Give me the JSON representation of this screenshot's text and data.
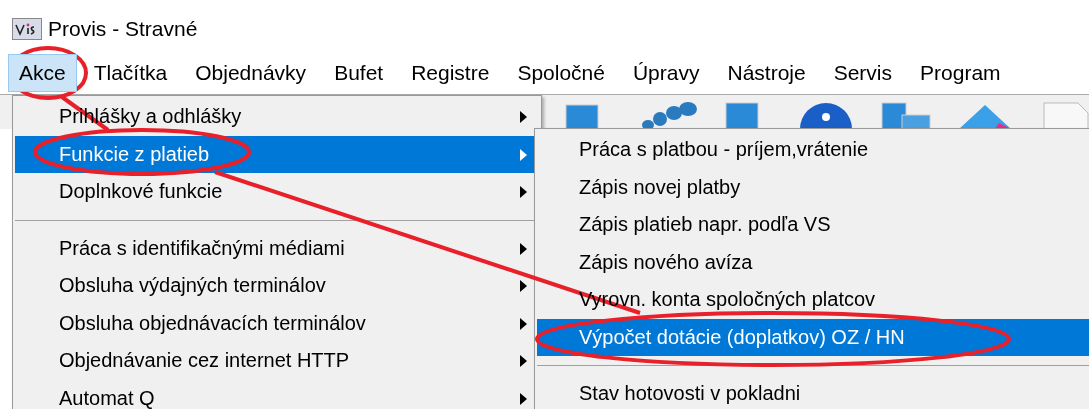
{
  "window": {
    "title": "Provis - Stravné"
  },
  "menu_bar": [
    {
      "label": "Akce",
      "selected": true
    },
    {
      "label": "Tlačítka",
      "selected": false
    },
    {
      "label": "Objednávky",
      "selected": false
    },
    {
      "label": "Bufet",
      "selected": false
    },
    {
      "label": "Registre",
      "selected": false
    },
    {
      "label": "Spoločné",
      "selected": false
    },
    {
      "label": "Úpravy",
      "selected": false
    },
    {
      "label": "Nástroje",
      "selected": false
    },
    {
      "label": "Servis",
      "selected": false
    },
    {
      "label": "Program",
      "selected": false
    }
  ],
  "menu": {
    "items": [
      {
        "kind": "item",
        "label": "Prihlášky a odhlášky",
        "submenu": true,
        "selected": false
      },
      {
        "kind": "item",
        "label": "Funkcie z platieb",
        "submenu": true,
        "selected": true
      },
      {
        "kind": "item",
        "label": "Doplnkové funkcie",
        "submenu": true,
        "selected": false
      },
      {
        "kind": "separator"
      },
      {
        "kind": "item",
        "label": "Práca s identifikačnými médiami",
        "submenu": true,
        "selected": false
      },
      {
        "kind": "item",
        "label": "Obsluha výdajných terminálov",
        "submenu": true,
        "selected": false
      },
      {
        "kind": "item",
        "label": "Obsluha objednávacích terminálov",
        "submenu": true,
        "selected": false
      },
      {
        "kind": "item",
        "label": "Objednávanie cez internet HTTP",
        "submenu": true,
        "selected": false
      },
      {
        "kind": "item",
        "label": "Automat Q",
        "submenu": true,
        "selected": false
      }
    ]
  },
  "submenu": {
    "items": [
      {
        "kind": "item",
        "label": "Práca s platbou - príjem,vrátenie",
        "selected": false
      },
      {
        "kind": "item",
        "label": "Zápis novej platby",
        "selected": false
      },
      {
        "kind": "item",
        "label": "Zápis platieb napr. podľa VS",
        "selected": false
      },
      {
        "kind": "item",
        "label": "Zápis nového avíza",
        "selected": false
      },
      {
        "kind": "item",
        "label": "Vyrovn. konta spoločných platcov",
        "selected": false
      },
      {
        "kind": "item",
        "label": "Výpočet dotácie (doplatkov) OZ / HN",
        "selected": true
      },
      {
        "kind": "separator"
      },
      {
        "kind": "item",
        "label": "Stav hotovosti v pokladni",
        "selected": false
      }
    ]
  }
}
